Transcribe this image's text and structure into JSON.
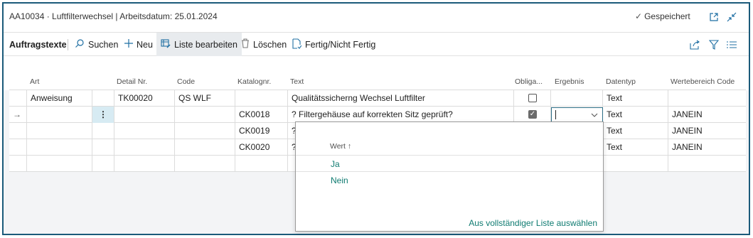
{
  "titlebar": {
    "title": "AA10034 · Luftfilterwechsel | Arbeitsdatum: 25.01.2024",
    "saved": "Gespeichert",
    "check_glyph": "✓"
  },
  "actionbar": {
    "tab": "Auftragstexte",
    "search": "Suchen",
    "new": "Neu",
    "edit_list": "Liste bearbeiten",
    "delete": "Löschen",
    "done": "Fertig/Nicht Fertig"
  },
  "columns": {
    "art": "Art",
    "detail": "Detail Nr.",
    "code": "Code",
    "katalog": "Katalognr.",
    "text": "Text",
    "oblig": "Obliga...",
    "ergebnis": "Ergebnis",
    "datentyp": "Datentyp",
    "wertebereich": "Wertebereich Code"
  },
  "rows": [
    {
      "art": "Anweisung",
      "detail": "TK00020",
      "code": "QS WLF",
      "katalog": "",
      "text": "Qualitätssicherng Wechsel Luftfilter",
      "oblig": false,
      "datentyp": "Text",
      "wertebereich": ""
    },
    {
      "art": "",
      "detail": "",
      "code": "",
      "katalog": "CK0018",
      "text": "? Filtergehäuse auf korrekten Sitz geprüft?",
      "oblig": true,
      "datentyp": "Text",
      "wertebereich": "JANEIN"
    },
    {
      "art": "",
      "detail": "",
      "code": "",
      "katalog": "CK0019",
      "text": "?",
      "oblig": null,
      "datentyp": "Text",
      "wertebereich": "JANEIN"
    },
    {
      "art": "",
      "detail": "",
      "code": "",
      "katalog": "CK0020",
      "text": "?",
      "oblig": null,
      "datentyp": "Text",
      "wertebereich": "JANEIN"
    }
  ],
  "row_arrow": "→",
  "row_menu": "⋮",
  "dropdown": {
    "header": "Wert ↑",
    "items": [
      "Ja",
      "Nein"
    ],
    "footer": "Aus vollständiger Liste auswählen"
  },
  "colors": {
    "accent": "#0f7b71",
    "frame": "#1b5a7a",
    "selected_cell": "#d7ebf3"
  }
}
